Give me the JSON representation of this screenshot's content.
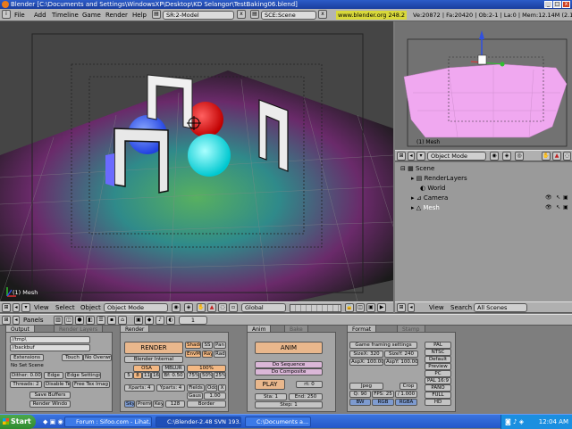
{
  "window": {
    "title": "Blender [C:\\Documents and Settings\\WindowsXP\\Desktop\\KD Selangor\\TestBaking06.blend]",
    "min": "_",
    "max": "□",
    "close": "x"
  },
  "menubar": {
    "items": [
      "File",
      "Add",
      "Timeline",
      "Game",
      "Render",
      "Help"
    ],
    "screen_field": "SR:2-Model",
    "scene_field": "SCE:Scene",
    "site": "www.blender.org 248.2",
    "stats": "Ve:20872 | Fa:20420 | Ob:2-1 | La:0 | Mem:12.14M (2.1"
  },
  "view3d": {
    "object_label": "(1) Mesh",
    "header": {
      "view": "View",
      "select": "Select",
      "object": "Object",
      "mode": "Object Mode",
      "orientation": "Global"
    }
  },
  "view_right": {
    "object_label": "(1) Mesh",
    "mode": "Object Mode"
  },
  "outliner": {
    "items": [
      {
        "label": "Scene",
        "indent": 0
      },
      {
        "label": "RenderLayers",
        "indent": 1
      },
      {
        "label": "World",
        "indent": 1
      },
      {
        "label": "Camera",
        "indent": 1
      },
      {
        "label": "Mesh",
        "indent": 1
      }
    ],
    "header": {
      "view": "View",
      "search": "Search",
      "scenes": "All Scenes"
    }
  },
  "buttons_header": {
    "panels": "Panels",
    "frame": "1"
  },
  "output_panel": {
    "tab_output": "Output",
    "tab_layers": "Render Layers",
    "path1": "//tmp\\",
    "path2": "//backbuf",
    "extensions": "Extensions",
    "touch": "Touch",
    "no_overwrite": "No Overwrit",
    "no_set_scene": "No Set Scene",
    "dither": "Dither: 0.000",
    "edge": "Edge",
    "edge_settings": "Edge Settings",
    "threads": "Threads: 2",
    "disable_tex": "Disable Te",
    "free_tex": "Free Tex Imag",
    "save_buffers": "Save Buffers",
    "render_window": "Render Windo"
  },
  "render_panel": {
    "tab": "Render",
    "render": "RENDER",
    "renderer": "Blender Internal",
    "shadow": "Shado",
    "sss": "SS",
    "pano": "Pan",
    "envmap": "EnvM",
    "ray": "Ray",
    "radio": "Radi",
    "osa": "OSA",
    "mblur": "MBLUR",
    "bf": "Bf: 0.50",
    "osa_vals": [
      "5",
      "8",
      "11",
      "16"
    ],
    "pct100": "100%",
    "pct75": "75%",
    "pct50": "50%",
    "pct25": "25%",
    "xparts": "Xparts: 4",
    "yparts": "Yparts: 4",
    "fields": "Fields",
    "odd": "Odd",
    "x": "X",
    "gaus": "Gaus",
    "gaus_val": "1.00",
    "sky": "Sky",
    "premul": "Premul",
    "key": "Key",
    "bits": "128",
    "border": "Border"
  },
  "anim_panel": {
    "tab_anim": "Anim",
    "tab_bake": "Bake",
    "anim": "ANIM",
    "do_sequence": "Do Sequence",
    "do_composite": "Do Composite",
    "play": "PLAY",
    "rt": "rt: 0",
    "sta": "Sta: 1",
    "end": "End: 250",
    "step": "Step: 1"
  },
  "format_panel": {
    "tab_format": "Format",
    "tab_stamp": "Stamp",
    "game_settings": "Game framing settings",
    "sizex": "SizeX: 320",
    "sizey": "SizeY: 240",
    "aspx": "AspX: 100.00",
    "aspy": "AspY: 100.00",
    "jpeg": "Jpeg",
    "crop": "Crop",
    "quality": "Q: 90",
    "fps": "FPS: 25",
    "fpsb": "/ 1.000",
    "bw": "BW",
    "rgb": "RGB",
    "rgba": "RGBA",
    "presets": [
      "PAL",
      "NTSC",
      "Default",
      "Preview",
      "PC",
      "PAL 16:9",
      "PANO",
      "FULL",
      "HD"
    ]
  },
  "taskbar": {
    "start": "Start",
    "tasks": [
      "Forum : Sifoo.com - Lihat...",
      "C:\\Blender-2.48 SVN 193...",
      "C:\\Documents a..."
    ],
    "clock": "12:04 AM"
  },
  "colors": {
    "accent": "#f3b883",
    "title": "#2c5cc8",
    "pink_plane": "#f0a8f0"
  }
}
